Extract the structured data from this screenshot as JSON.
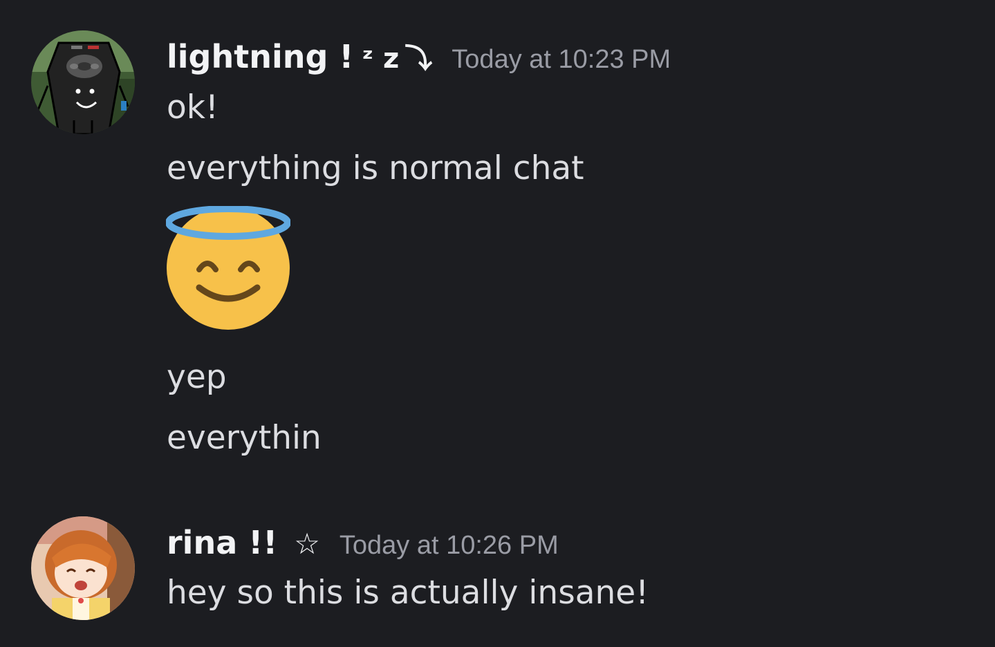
{
  "messages": [
    {
      "author": "lightning !",
      "author_suffix": "ᶻ z",
      "author_badge": "⤵",
      "timestamp": "Today at 10:23 PM",
      "avatar_icon": "remote-control-character-avatar",
      "lines": [
        "ok!",
        "everything is normal chat"
      ],
      "emoji": "smiling-face-with-halo",
      "lines_after": [
        "yep",
        "everythin"
      ]
    },
    {
      "author": "rina !!",
      "author_badge": "☆",
      "timestamp": "Today at 10:26 PM",
      "avatar_icon": "anime-girl-avatar",
      "lines": [
        "hey so this is actually insane!"
      ]
    }
  ],
  "colors": {
    "background": "#1c1d21",
    "username": "#f2f3f5",
    "message_text": "#dcdde1",
    "timestamp": "#9a9ca5",
    "emoji_face": "#f7c14a",
    "emoji_halo": "#5fa8e0"
  }
}
